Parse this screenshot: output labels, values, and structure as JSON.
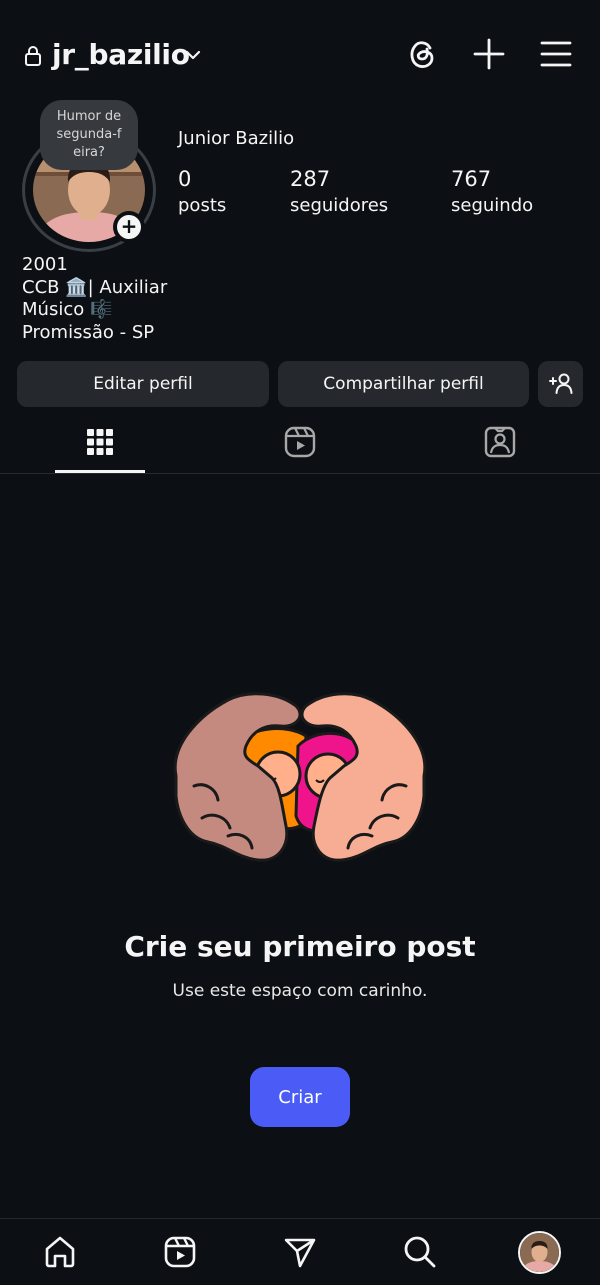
{
  "header": {
    "username": "jr_bazilio",
    "icons": [
      "lock-icon",
      "chevron-down-icon",
      "threads-icon",
      "plus-icon",
      "menu-icon"
    ]
  },
  "profile": {
    "note": "Humor de\nsegunda-f\neira?",
    "display_name": "Junior Bazilio",
    "stats": [
      {
        "value": "0",
        "label": "posts"
      },
      {
        "value": "287",
        "label": "seguidores"
      },
      {
        "value": "767",
        "label": "seguindo"
      }
    ],
    "bio": [
      "2001",
      "CCB 🏛️| Auxiliar",
      "Músico 🎼",
      "Promissão - SP"
    ]
  },
  "actions": {
    "edit": "Editar perfil",
    "share": "Compartilhar perfil"
  },
  "tabs": [
    "grid-icon",
    "reels-icon",
    "tagged-icon"
  ],
  "empty_state": {
    "title": "Crie seu primeiro post",
    "subtitle": "Use este espaço com carinho.",
    "button": "Criar"
  },
  "bottom_nav": [
    "home-icon",
    "reels-icon",
    "send-icon",
    "search-icon",
    "profile-avatar"
  ],
  "colors": {
    "background": "#0c1014",
    "button_bg": "#25292e",
    "accent": "#4a5cf5",
    "text": "#f5f5f5"
  }
}
